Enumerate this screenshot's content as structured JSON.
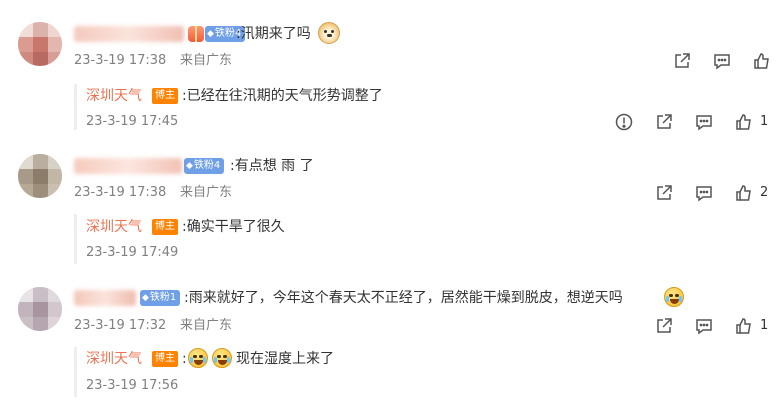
{
  "comments": [
    {
      "user": {
        "name": "",
        "fan_badge": "铁粉4",
        "gift_badge": true
      },
      "text": ":汛期来了吗",
      "emoji": "doge-emoji",
      "time": "23-3-19 17:38",
      "location": "来自广东",
      "actions": [
        "share-icon",
        "comment-icon",
        "like-icon"
      ],
      "like_count": "",
      "reply": {
        "author": "深圳天气",
        "host_badge": "博主",
        "text": ":已经在往汛期的天气形势调整了",
        "time": "23-3-19 17:45",
        "actions": [
          "report-icon",
          "share-icon",
          "comment-icon",
          "like-icon"
        ],
        "like_count": "1"
      }
    },
    {
      "user": {
        "name": "",
        "fan_badge": "铁粉4"
      },
      "text": ":有点想 雨 了",
      "time": "23-3-19 17:38",
      "location": "来自广东",
      "actions": [
        "share-icon",
        "comment-icon",
        "like-icon"
      ],
      "like_count": "2",
      "reply": {
        "author": "深圳天气",
        "host_badge": "博主",
        "text": ":确实干旱了很久",
        "time": "23-3-19 17:49"
      }
    },
    {
      "user": {
        "name": "",
        "fan_badge": "铁粉1"
      },
      "text": ":雨来就好了，今年这个春天太不正经了，居然能干燥到脱皮，想逆天吗",
      "emoji": "crying-laugh-emoji",
      "time": "23-3-19 17:32",
      "location": "来自广东",
      "actions": [
        "share-icon",
        "comment-icon",
        "like-icon"
      ],
      "like_count": "1",
      "reply": {
        "author": "深圳天气",
        "host_badge": "博主",
        "prefix": ":",
        "text": "现在湿度上来了",
        "emojis": [
          "crying-laugh-emoji",
          "crying-laugh-emoji"
        ],
        "time": "23-3-19 17:56"
      }
    }
  ],
  "colors": {
    "name": "#eb7350",
    "meta": "#808080",
    "host_badge": "#ff8200",
    "fan_badge": "#6f9fe6"
  }
}
